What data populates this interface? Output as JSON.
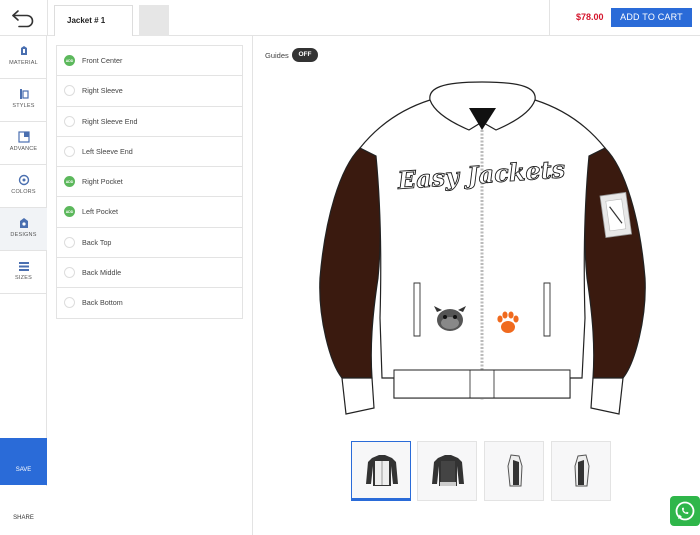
{
  "header": {
    "tab_label": "Jacket # 1",
    "price": "$78.00",
    "cart_label": "ADD TO CART"
  },
  "sidebar": {
    "items": [
      {
        "label": "MATERIAL",
        "icon": "material-icon"
      },
      {
        "label": "STYLES",
        "icon": "styles-icon"
      },
      {
        "label": "ADVANCE",
        "icon": "advance-icon"
      },
      {
        "label": "COLORS",
        "icon": "colors-icon"
      },
      {
        "label": "DESIGNS",
        "icon": "designs-icon",
        "active": true
      },
      {
        "label": "SIZES",
        "icon": "sizes-icon"
      }
    ],
    "save_label": "SAVE",
    "share_label": "SHARE"
  },
  "locations": [
    {
      "name": "Front Center",
      "selected": true
    },
    {
      "name": "Right Sleeve",
      "selected": false
    },
    {
      "name": "Right Sleeve End",
      "selected": false
    },
    {
      "name": "Left Sleeve End",
      "selected": false
    },
    {
      "name": "Right Pocket",
      "selected": true
    },
    {
      "name": "Left Pocket",
      "selected": true
    },
    {
      "name": "Back Top",
      "selected": false
    },
    {
      "name": "Back Middle",
      "selected": false
    },
    {
      "name": "Back Bottom",
      "selected": false
    }
  ],
  "check_badge": "ADD",
  "guides": {
    "label": "Guides",
    "state": "OFF"
  },
  "jacket": {
    "script_text": "Easy Jackets",
    "body_color": "#ffffff",
    "sleeve_color": "#3a1a0f",
    "paw_color": "#f06a1e"
  },
  "views": [
    "front",
    "back",
    "left-side",
    "right-side"
  ],
  "colors": {
    "accent": "#2a6bd8",
    "price": "#d4152c",
    "check": "#5cb85c",
    "whatsapp": "#2fb64a"
  }
}
